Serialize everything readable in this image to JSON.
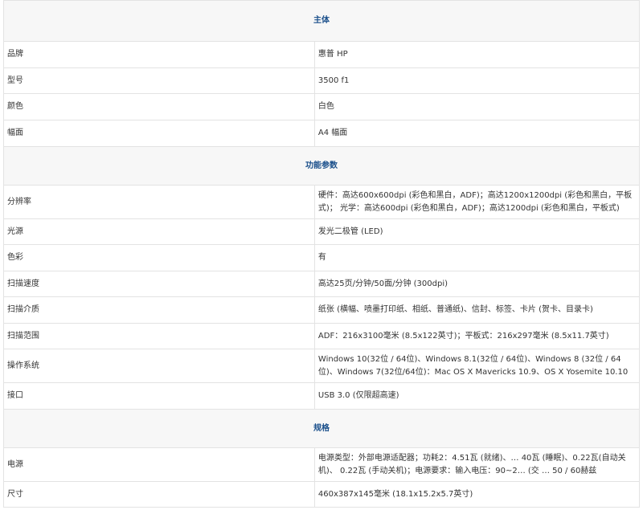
{
  "sections": [
    {
      "title": "主体",
      "rows": [
        {
          "label": "品牌",
          "value": "惠普 HP"
        },
        {
          "label": "型号",
          "value": "3500 f1"
        },
        {
          "label": "颜色",
          "value": "白色"
        },
        {
          "label": "幅面",
          "value": "A4 幅面"
        }
      ]
    },
    {
      "title": "功能参数",
      "rows": [
        {
          "label": "分辨率",
          "value": "硬件：高达600x600dpi (彩色和黑白，ADF)；高达1200x1200dpi (彩色和黑白，平板式)； 光学：高达600dpi (彩色和黑白，ADF)；高达1200dpi (彩色和黑白，平板式)"
        },
        {
          "label": "光源",
          "value": "发光二极管 (LED)"
        },
        {
          "label": "色彩",
          "value": "有"
        },
        {
          "label": "扫描速度",
          "value": "高达25页/分钟/50面/分钟 (300dpi)"
        },
        {
          "label": "扫描介质",
          "value": "纸张 (横幅、喷墨打印纸、相纸、普通纸)、信封、标签、卡片 (贺卡、目录卡)"
        },
        {
          "label": "扫描范围",
          "value": "ADF：216x3100毫米 (8.5x122英寸)；平板式：216x297毫米 (8.5x11.7英寸)"
        },
        {
          "label": "操作系统",
          "value": "Windows 10(32位 / 64位)、Windows 8.1(32位 / 64位)、Windows 8 (32位 / 64位)、Windows 7(32位/64位)：Mac OS X Mavericks 10.9、OS X Yosemite 10.10"
        },
        {
          "label": "接口",
          "value": "USB 3.0 (仅限超高速)"
        }
      ]
    },
    {
      "title": "规格",
      "rows": [
        {
          "label": "电源",
          "value": "电源类型：外部电源适配器；功耗2：4.51瓦 (就绪)、… 40瓦 (睡眠)、0.22瓦(自动关机)、 0.22瓦 (手动关机)；电源要求：输入电压：90~2… (交 … 50 / 60赫兹"
        },
        {
          "label": "尺寸",
          "value": "460x387x145毫米 (18.1x15.2x5.7英寸)"
        }
      ]
    }
  ]
}
